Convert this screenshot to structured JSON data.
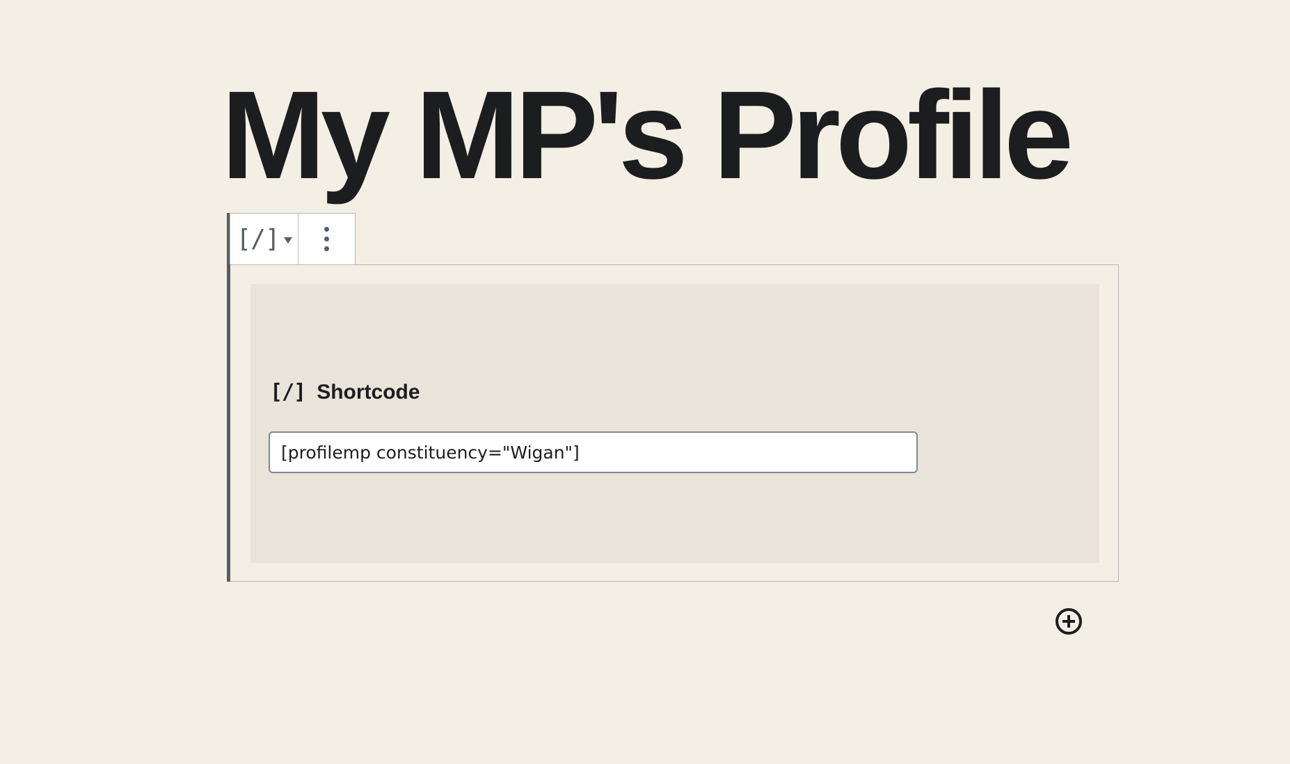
{
  "post": {
    "title": "My MP's Profile"
  },
  "toolbar": {
    "block_icon": "[/]",
    "block_switcher_icon": "shortcode-icon",
    "more_options_icon": "more-vertical-icon"
  },
  "shortcode_block": {
    "icon": "[/]",
    "label": "Shortcode",
    "value": "[profilemp constituency=\"Wigan\"]"
  },
  "inserter": {
    "icon": "plus-circle-icon"
  },
  "colors": {
    "background": "#f4efe4",
    "placeholder_bg": "#e8e4d9",
    "text": "#1c1d1f",
    "toolbar_icon": "#555d66",
    "border": "#b5b5b5"
  }
}
